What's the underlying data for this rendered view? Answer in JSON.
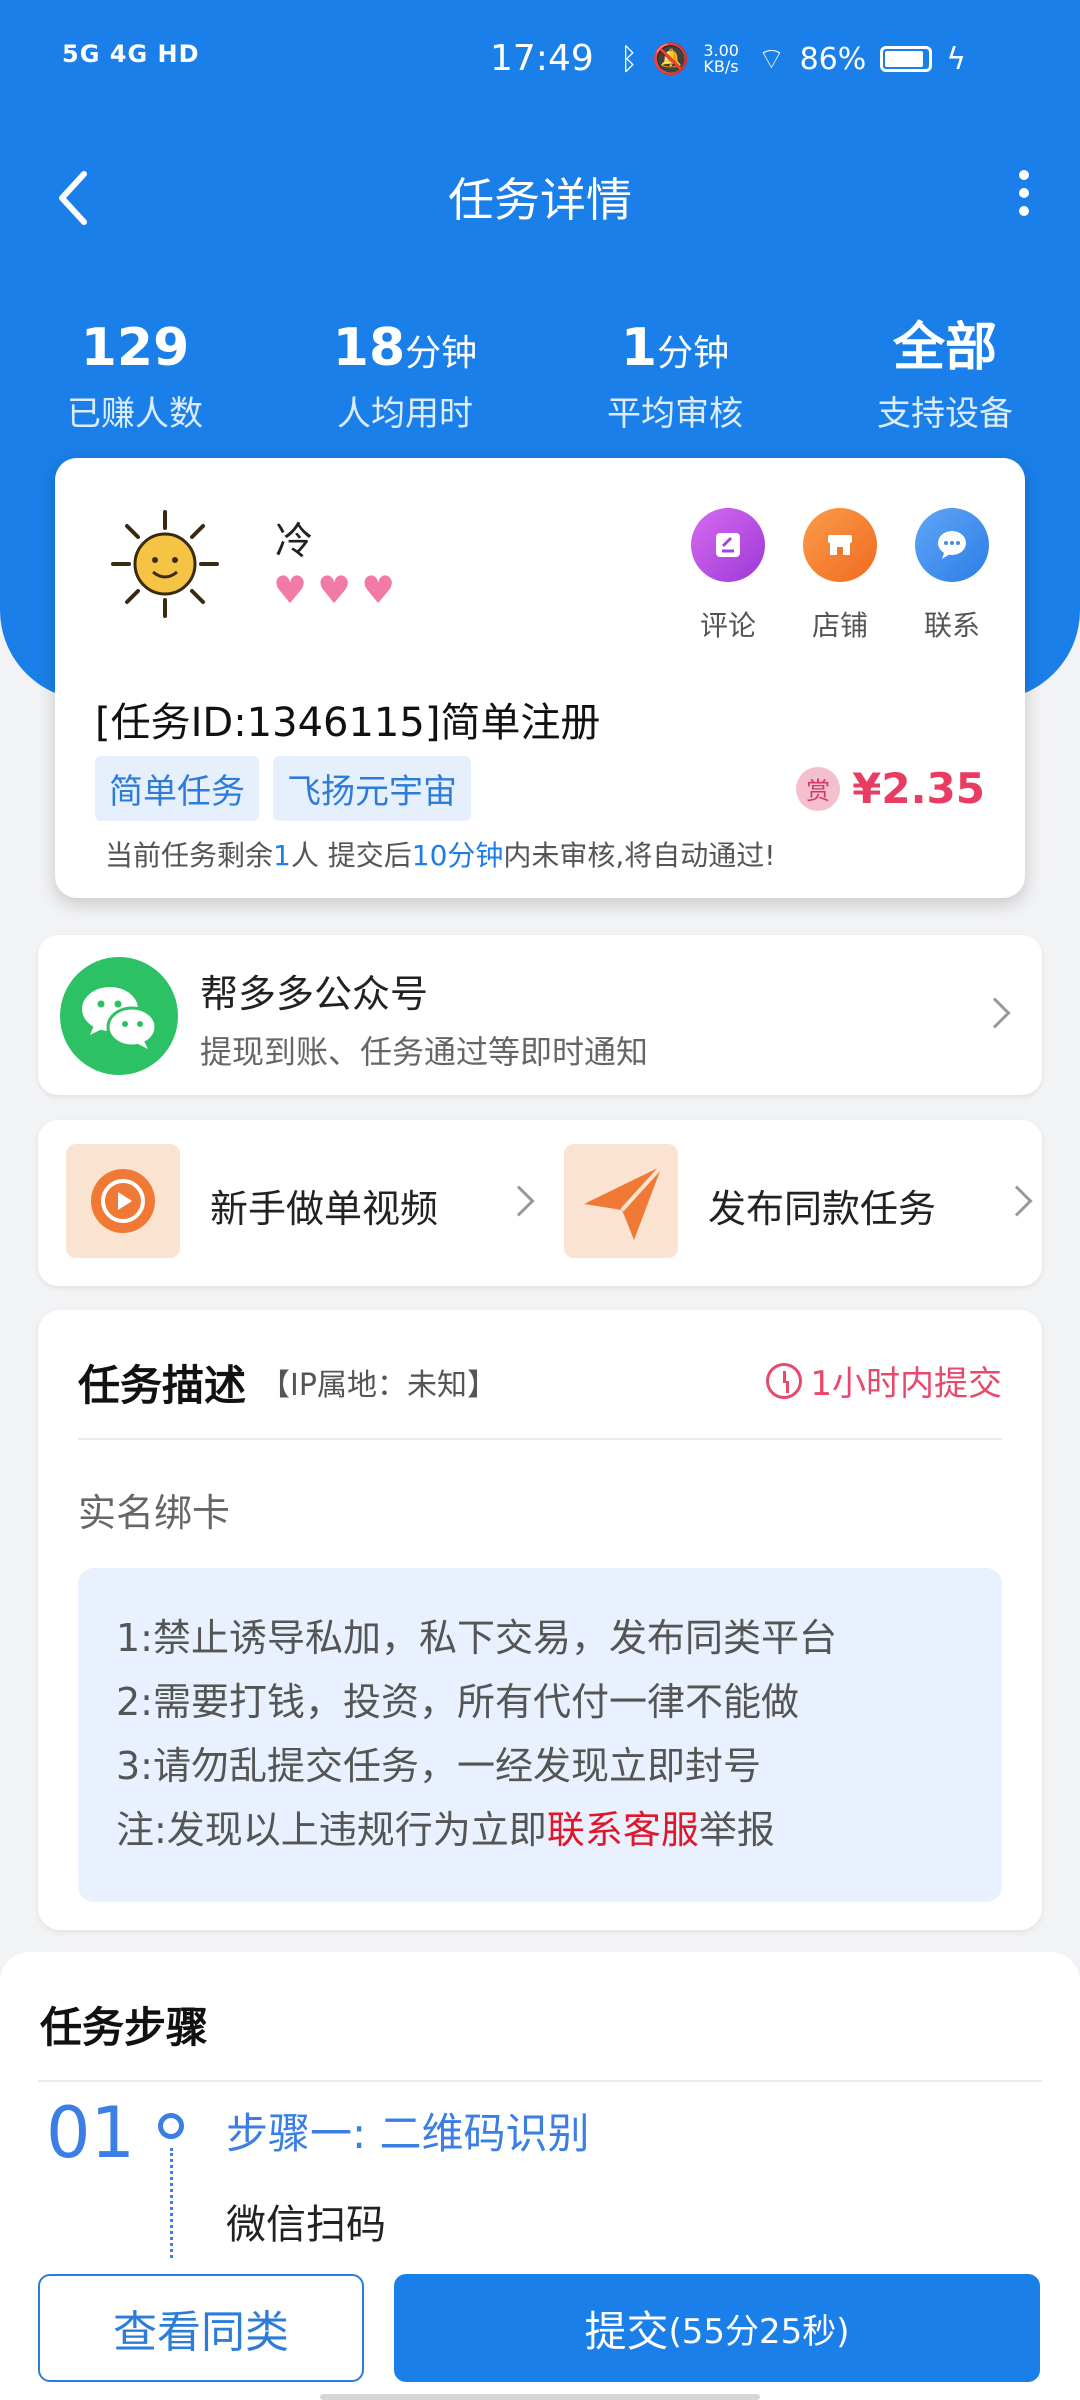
{
  "status_bar": {
    "network": "5G 4G HD",
    "time": "17:49",
    "speed": "3.00 KB/s",
    "battery": "86%"
  },
  "nav": {
    "title": "任务详情"
  },
  "stats": [
    {
      "value": "129",
      "unit": "",
      "label": "已赚人数"
    },
    {
      "value": "18",
      "unit": "分钟",
      "label": "人均用时"
    },
    {
      "value": "1",
      "unit": "分钟",
      "label": "平均审核"
    },
    {
      "value": "全部",
      "unit": "",
      "label": "支持设备"
    }
  ],
  "publisher": {
    "name": "冷",
    "hearts": 3
  },
  "actions": [
    {
      "label": "评论",
      "icon": "comment-icon",
      "color": "#b44be0"
    },
    {
      "label": "店铺",
      "icon": "shop-icon",
      "color": "#f3782b"
    },
    {
      "label": "联系",
      "icon": "chat-icon",
      "color": "#3f8ef0"
    }
  ],
  "task": {
    "title": "[任务ID:1346115]简单注册",
    "tags": [
      "简单任务",
      "飞扬元宇宙"
    ],
    "reward_badge": "赏",
    "reward": "¥2.35",
    "note_prefix": "当前任务剩余",
    "note_remaining": "1",
    "note_mid": "人  提交后",
    "note_time": "10分钟",
    "note_suffix": "内未审核,将自动通过!"
  },
  "wechat": {
    "title": "帮多多公众号",
    "subtitle": "提现到账、任务通过等即时通知"
  },
  "promos": [
    {
      "label": "新手做单视频",
      "icon": "play-icon"
    },
    {
      "label": "发布同款任务",
      "icon": "send-icon"
    }
  ],
  "description": {
    "title": "任务描述",
    "ip": "【IP属地：未知】",
    "deadline": "1小时内提交",
    "subtitle": "实名绑卡",
    "rules": [
      "1:禁止诱导私加，私下交易，发布同类平台",
      "2:需要打钱，投资，所有代付一律不能做",
      "3:请勿乱提交任务，一经发现立即封号"
    ],
    "note_prefix": "注:发现以上违规行为立即",
    "note_link": "联系客服",
    "note_suffix": "举报"
  },
  "steps": {
    "title": "任务步骤",
    "items": [
      {
        "num": "01",
        "title": "步骤一: 二维码识别",
        "desc": "微信扫码"
      }
    ]
  },
  "bottom": {
    "similar": "查看同类",
    "submit": "提交",
    "countdown": "(55分25秒)"
  },
  "colors": {
    "primary": "#1a7fe8",
    "reward": "#e83c63",
    "deadline": "#e9486b",
    "wechat": "#2bc164"
  }
}
